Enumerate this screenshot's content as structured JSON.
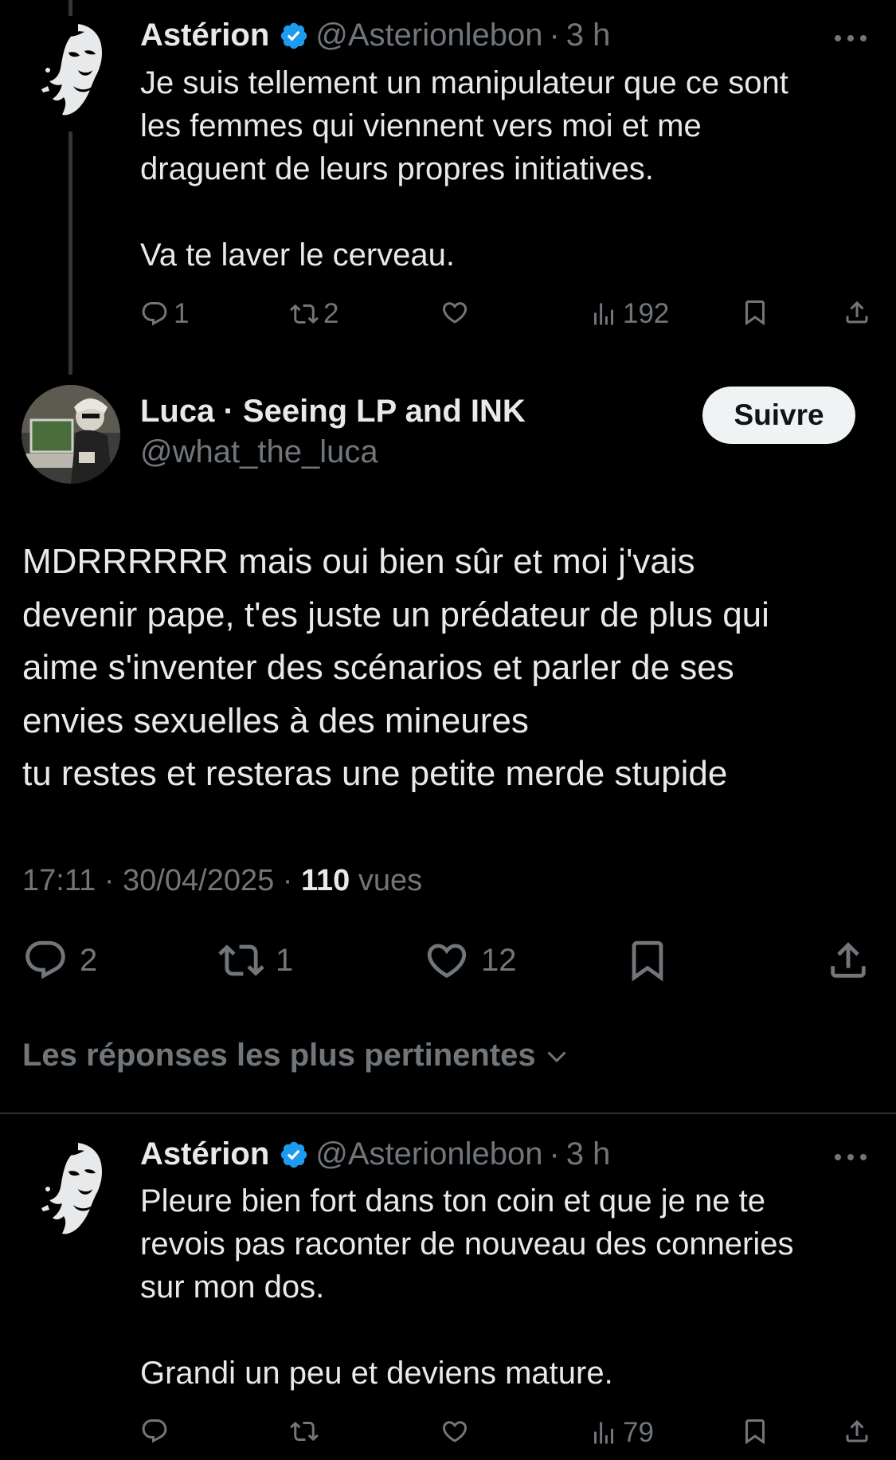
{
  "parent_tweet": {
    "author_name": "Astérion",
    "handle": "@Asterionlebon",
    "time": "3 h",
    "text": "Je suis tellement un manipulateur que ce sont\nles femmes qui viennent vers moi et me\ndraguent de leurs propres initiatives.\n\nVa te laver le cerveau.",
    "replies": "1",
    "reposts": "2",
    "likes": "",
    "views": "192"
  },
  "main_tweet": {
    "author_name": "Luca · Seeing LP and INK",
    "handle": "@what_the_luca",
    "follow_label": "Suivre",
    "text": "MDRRRRRR mais oui bien sûr et moi j'vais\ndevenir pape, t'es juste un prédateur de plus qui\naime s'inventer des scénarios et parler de ses\nenvies sexuelles à des mineures\ntu restes et resteras une petite merde stupide",
    "timestamp": "17:11 · 30/04/2025 · ",
    "views_count": "110",
    "views_label": "vues",
    "replies": "2",
    "reposts": "1",
    "likes": "12"
  },
  "sort": {
    "label": "Les réponses les plus pertinentes"
  },
  "reply_tweet": {
    "author_name": "Astérion",
    "handle": "@Asterionlebon",
    "time": "3 h",
    "text": "Pleure bien fort dans ton coin et que je ne te\nrevois pas raconter de nouveau des conneries\nsur mon dos.\n\nGrandi un peu et deviens mature.",
    "replies": "",
    "reposts": "",
    "likes": "",
    "views": "79"
  },
  "colors": {
    "background": "#000000",
    "text": "#e7e9ea",
    "secondary": "#71767b",
    "verified": "#1d9bf0",
    "follow_bg": "#eff3f4"
  },
  "icons": {
    "reply": "speech-bubble-icon",
    "repost": "repost-arrows-icon",
    "like": "heart-icon",
    "views": "bar-chart-icon",
    "bookmark": "bookmark-icon",
    "share": "share-upload-icon",
    "more": "ellipsis-icon",
    "verified": "verified-badge-icon",
    "sort": "chevron-down-icon"
  }
}
